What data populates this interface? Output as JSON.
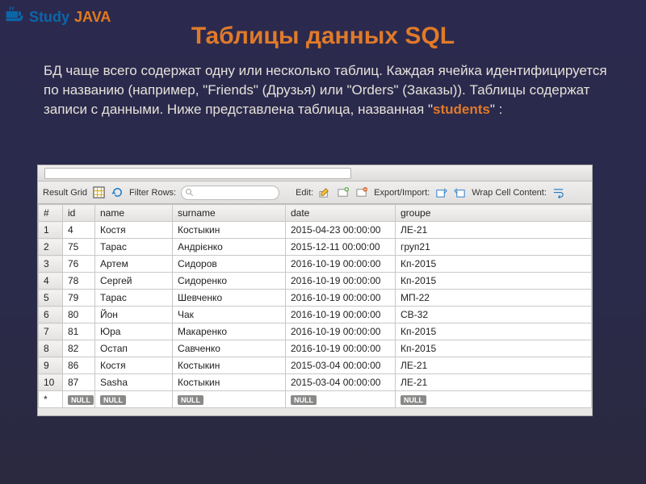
{
  "logo": {
    "text1": "Study ",
    "text2": "JAVA"
  },
  "title": "Таблицы данных SQL",
  "blurb": {
    "pre": "БД чаще всего содержат одну или несколько таблиц. Каждая ячейка идентифицируется по названию (например, \"Friends\" (Друзья) или \"Orders\" (Заказы)). Таблицы содержат записи с данными. Ниже представлена таблица, названная \"",
    "hl": "students",
    "post": "\" :"
  },
  "tool": {
    "resultgrid": "Result Grid",
    "filterrows": "Filter Rows:",
    "edit": "Edit:",
    "exportimport": "Export/Import:",
    "wrap": "Wrap Cell Content:",
    "filter_placeholder": ""
  },
  "headers": {
    "num": "#",
    "id": "id",
    "name": "name",
    "surname": "surname",
    "date": "date",
    "groupe": "groupe"
  },
  "rows": [
    {
      "n": "1",
      "id": "4",
      "name": "Костя",
      "surname": "Костыкин",
      "date": "2015-04-23 00:00:00",
      "groupe": "ЛЕ-21"
    },
    {
      "n": "2",
      "id": "75",
      "name": "Тарас",
      "surname": "Андрієнко",
      "date": "2015-12-11 00:00:00",
      "groupe": "груп21"
    },
    {
      "n": "3",
      "id": "76",
      "name": "Артем",
      "surname": "Сидоров",
      "date": "2016-10-19 00:00:00",
      "groupe": "Кп-2015"
    },
    {
      "n": "4",
      "id": "78",
      "name": "Сергей",
      "surname": "Сидоренко",
      "date": "2016-10-19 00:00:00",
      "groupe": "Кп-2015"
    },
    {
      "n": "5",
      "id": "79",
      "name": "Тарас",
      "surname": "Шевченко",
      "date": "2016-10-19 00:00:00",
      "groupe": "МП-22"
    },
    {
      "n": "6",
      "id": "80",
      "name": "Йон",
      "surname": "Чак",
      "date": "2016-10-19 00:00:00",
      "groupe": "СВ-32"
    },
    {
      "n": "7",
      "id": "81",
      "name": "Юра",
      "surname": "Макаренко",
      "date": "2016-10-19 00:00:00",
      "groupe": "Кп-2015"
    },
    {
      "n": "8",
      "id": "82",
      "name": "Остап",
      "surname": "Савченко",
      "date": "2016-10-19 00:00:00",
      "groupe": "Кп-2015"
    },
    {
      "n": "9",
      "id": "86",
      "name": "Костя",
      "surname": "Костыкин",
      "date": "2015-03-04 00:00:00",
      "groupe": "ЛЕ-21"
    },
    {
      "n": "10",
      "id": "87",
      "name": "Sasha",
      "surname": "Костыкин",
      "date": "2015-03-04 00:00:00",
      "groupe": "ЛЕ-21"
    }
  ],
  "null_label": "NULL",
  "blank_marker": "*"
}
